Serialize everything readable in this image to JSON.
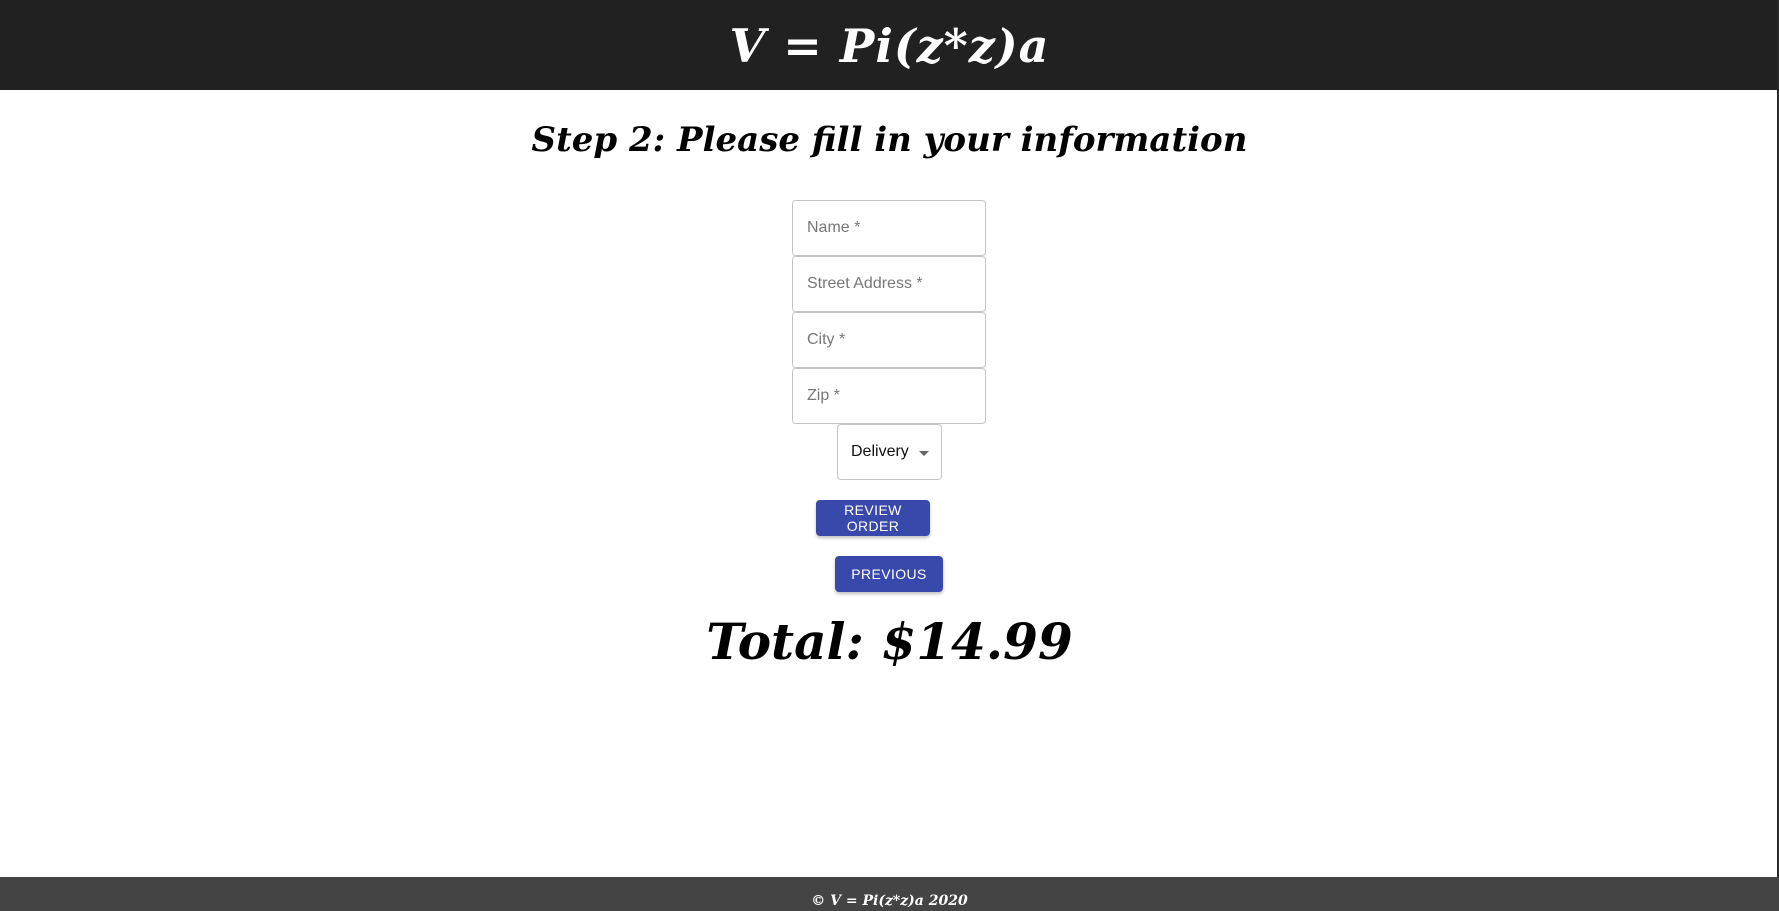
{
  "header": {
    "brand": "V = Pi(z*z)a"
  },
  "step_title": "Step 2: Please fill in your information",
  "form": {
    "fields": [
      {
        "placeholder": "Name *",
        "value": ""
      },
      {
        "placeholder": "Street Address *",
        "value": ""
      },
      {
        "placeholder": "City *",
        "value": ""
      },
      {
        "placeholder": "Zip *",
        "value": ""
      }
    ],
    "order_type": {
      "selected": "Delivery"
    }
  },
  "buttons": {
    "review": "Review Order",
    "previous": "Previous"
  },
  "total": "Total: $14.99",
  "footer": {
    "text": "© V = Pi(z*z)a 2020"
  },
  "colors": {
    "header_bg": "#212121",
    "button_bg": "#3949ab",
    "footer_bg": "#444444"
  }
}
